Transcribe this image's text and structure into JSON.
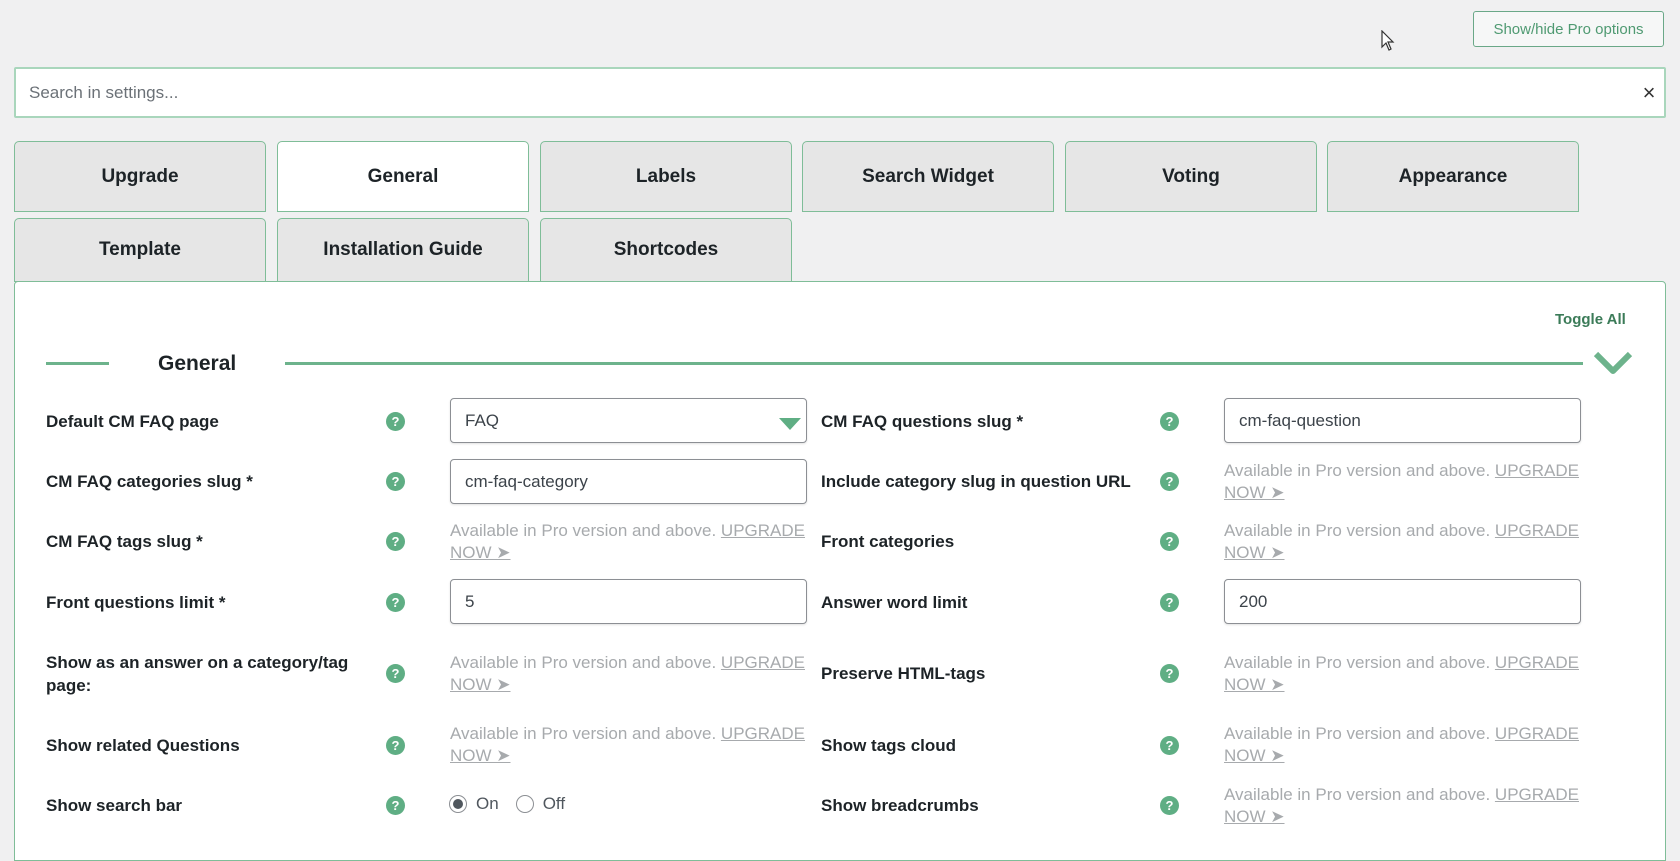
{
  "header": {
    "pro_toggle_label": "Show/hide Pro options"
  },
  "search": {
    "placeholder": "Search in settings...",
    "clear_symbol": "×"
  },
  "tabs": [
    {
      "label": "Upgrade"
    },
    {
      "label": "General"
    },
    {
      "label": "Labels"
    },
    {
      "label": "Search Widget"
    },
    {
      "label": "Voting"
    },
    {
      "label": "Appearance"
    },
    {
      "label": "Template"
    },
    {
      "label": "Installation Guide"
    },
    {
      "label": "Shortcodes"
    }
  ],
  "panel": {
    "toggle_all": "Toggle All",
    "section_title": "General",
    "help_symbol": "?",
    "pro_text": "Available in Pro version and above. ",
    "upgrade_link": "UPGRADE NOW ➤",
    "settings": {
      "default_page": {
        "label": "Default CM FAQ page",
        "value": "FAQ"
      },
      "questions_slug": {
        "label": "CM FAQ questions slug *",
        "value": "cm-faq-question"
      },
      "categories_slug": {
        "label": "CM FAQ categories slug *",
        "value": "cm-faq-category"
      },
      "include_category_slug": {
        "label": "Include category slug in question URL"
      },
      "tags_slug": {
        "label": "CM FAQ tags slug *"
      },
      "front_categories": {
        "label": "Front categories"
      },
      "front_questions_limit": {
        "label": "Front questions limit *",
        "value": "5"
      },
      "answer_word_limit": {
        "label": "Answer word limit",
        "value": "200"
      },
      "show_as_answer": {
        "label": "Show as an answer on a category/tag page:"
      },
      "preserve_html": {
        "label": "Preserve HTML-tags"
      },
      "show_related": {
        "label": "Show related Questions"
      },
      "show_tags_cloud": {
        "label": "Show tags cloud"
      },
      "show_search_bar": {
        "label": "Show search bar",
        "on": "On",
        "off": "Off",
        "selected": "On"
      },
      "show_breadcrumbs": {
        "label": "Show breadcrumbs"
      }
    }
  },
  "colors": {
    "accent": "#6db38c",
    "tab_border": "#7fbd98",
    "muted_text": "#a7aaad"
  }
}
